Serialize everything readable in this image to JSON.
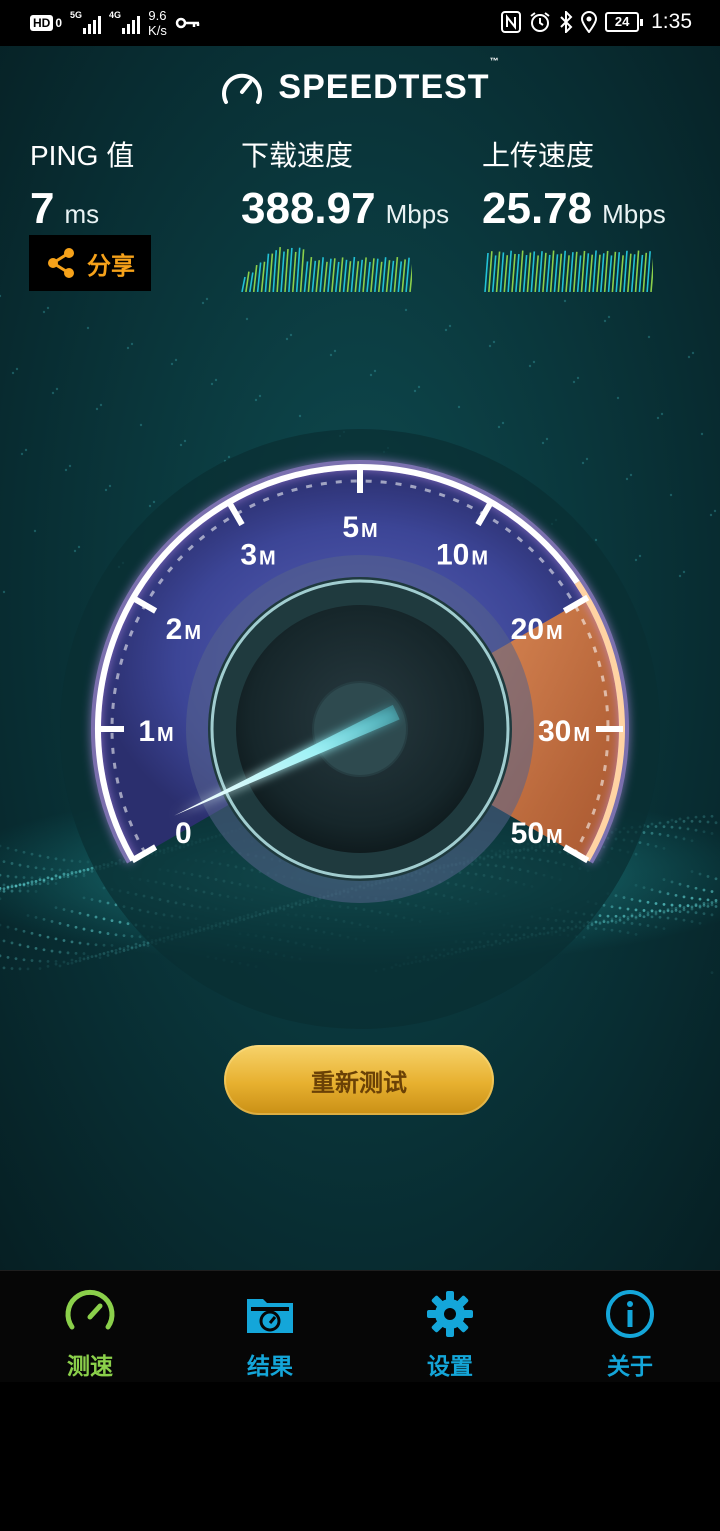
{
  "status_bar": {
    "hd_label": "HD",
    "hd_sub": "0",
    "sim1_label": "5G",
    "sim2_label": "4G",
    "net_speed_value": "9.6",
    "net_speed_unit": "K/s",
    "battery": "24",
    "time": "1:35",
    "icons": [
      "nfc-icon",
      "alarm-icon",
      "bluetooth-icon",
      "location-icon"
    ]
  },
  "app": {
    "logo_text": "SPEEDTEST",
    "logo_tm": "™",
    "ping": {
      "label": "PING 值",
      "value": "7",
      "unit": "ms"
    },
    "download": {
      "label": "下载速度",
      "value": "388.97",
      "unit": "Mbps"
    },
    "upload": {
      "label": "上传速度",
      "value": "25.78",
      "unit": "Mbps"
    },
    "share_label": "分享",
    "gauge": {
      "tick_labels": [
        {
          "num": "0",
          "unit": ""
        },
        {
          "num": "1",
          "unit": "M"
        },
        {
          "num": "2",
          "unit": "M"
        },
        {
          "num": "3",
          "unit": "M"
        },
        {
          "num": "5",
          "unit": "M"
        },
        {
          "num": "10",
          "unit": "M"
        },
        {
          "num": "20",
          "unit": "M"
        },
        {
          "num": "30",
          "unit": "M"
        },
        {
          "num": "50",
          "unit": "M"
        }
      ]
    },
    "retest_label": "重新测试"
  },
  "bottom_nav": [
    {
      "label": "测速",
      "icon": "speedometer-icon",
      "active": true
    },
    {
      "label": "结果",
      "icon": "results-folder-icon",
      "active": false
    },
    {
      "label": "设置",
      "icon": "gear-icon",
      "active": false
    },
    {
      "label": "关于",
      "icon": "info-icon",
      "active": false
    }
  ],
  "colors": {
    "accent_active": "#8bd04b",
    "accent_nav": "#14a6d9",
    "share_orange": "#f6a21a",
    "button_gold": "#e7b02f"
  }
}
